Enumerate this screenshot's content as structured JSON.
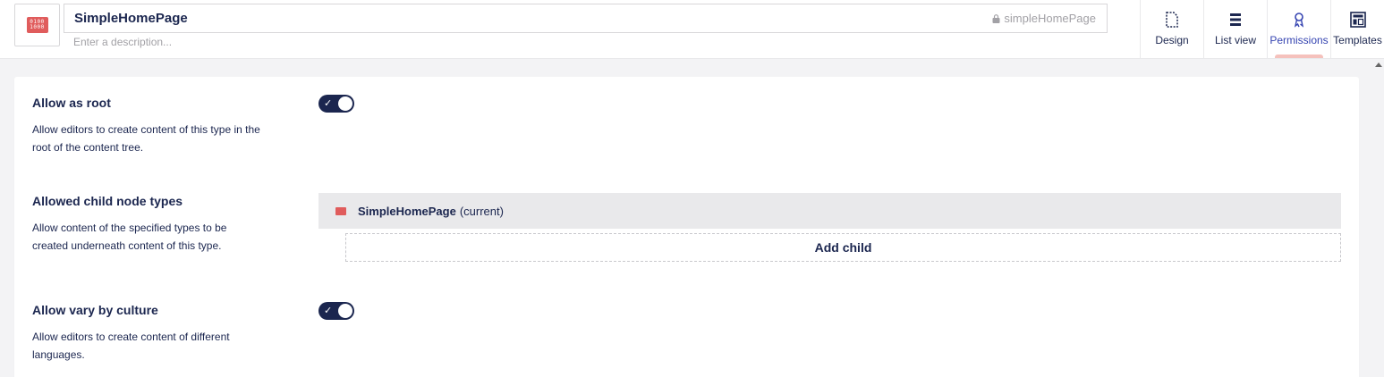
{
  "header": {
    "doc_type_icon": "binary-doc-icon",
    "icon_lines": [
      "0100",
      "1000"
    ],
    "name": "SimpleHomePage",
    "alias": "simpleHomePage",
    "description_placeholder": "Enter a description...",
    "tabs": [
      {
        "label": "Design",
        "icon": "document-icon",
        "active": false
      },
      {
        "label": "List view",
        "icon": "list-icon",
        "active": false
      },
      {
        "label": "Permissions",
        "icon": "key-icon",
        "active": true
      },
      {
        "label": "Templates",
        "icon": "template-icon",
        "active": false
      }
    ]
  },
  "permissions": {
    "allow_root": {
      "label": "Allow as root",
      "description": "Allow editors to create content of this type in the root of the content tree.",
      "enabled": true
    },
    "allowed_child": {
      "label": "Allowed child node types",
      "description": "Allow content of the specified types to be created underneath content of this type.",
      "children": [
        {
          "name": "SimpleHomePage",
          "suffix": "(current)"
        }
      ],
      "add_child_label": "Add child"
    },
    "vary_culture": {
      "label": "Allow vary by culture",
      "description": "Allow editors to create content of different languages.",
      "enabled": true
    }
  },
  "colors": {
    "primary": "#1b264f",
    "accent_red": "#e05c5c",
    "active_tab": "#3544b1",
    "active_indicator": "#f5c1bc"
  }
}
